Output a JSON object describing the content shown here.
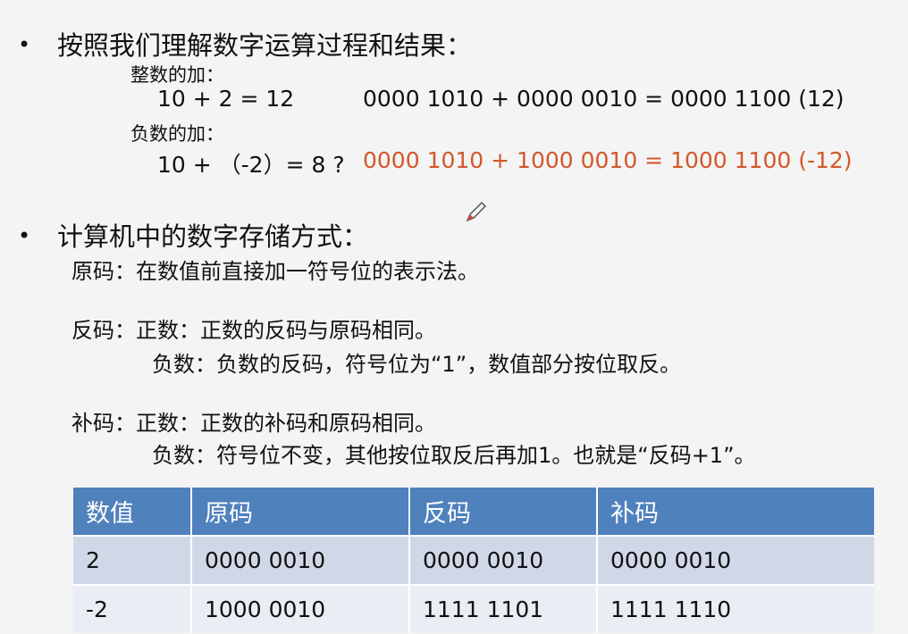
{
  "section1": {
    "bullet": "•",
    "title": "按照我们理解数字运算过程和结果：",
    "int_label": "整数的加：",
    "int_decimal": "10 + 2 = 12",
    "int_binary": "0000 1010 + 0000 0010 = 0000 1100 (12)",
    "neg_label": "负数的加：",
    "neg_decimal": "10 + （-2）= 8 ?",
    "neg_binary": "0000 1010 + 1000 0010 = 1000 1100 (-12)"
  },
  "section2": {
    "bullet": "•",
    "title": "计算机中的数字存储方式：",
    "yuanma": "原码：在数值前直接加一符号位的表示法。",
    "fanma_pos": "反码：正数：正数的反码与原码相同。",
    "fanma_neg": "负数：负数的反码，符号位为“1”，数值部分按位取反。",
    "buma_pos": "补码：正数：正数的补码和原码相同。",
    "buma_neg": "负数：符号位不变，其他按位取反后再加1。也就是“反码+1”。"
  },
  "table": {
    "headers": [
      "数值",
      "原码",
      "反码",
      "补码"
    ],
    "rows": [
      [
        "2",
        "0000 0010",
        "0000 0010",
        "0000 0010"
      ],
      [
        "-2",
        "1000 0010",
        "1111 1101",
        "1111 1110"
      ]
    ]
  },
  "colors": {
    "accent_red": "#d4572a",
    "table_header": "#4f81bd"
  }
}
